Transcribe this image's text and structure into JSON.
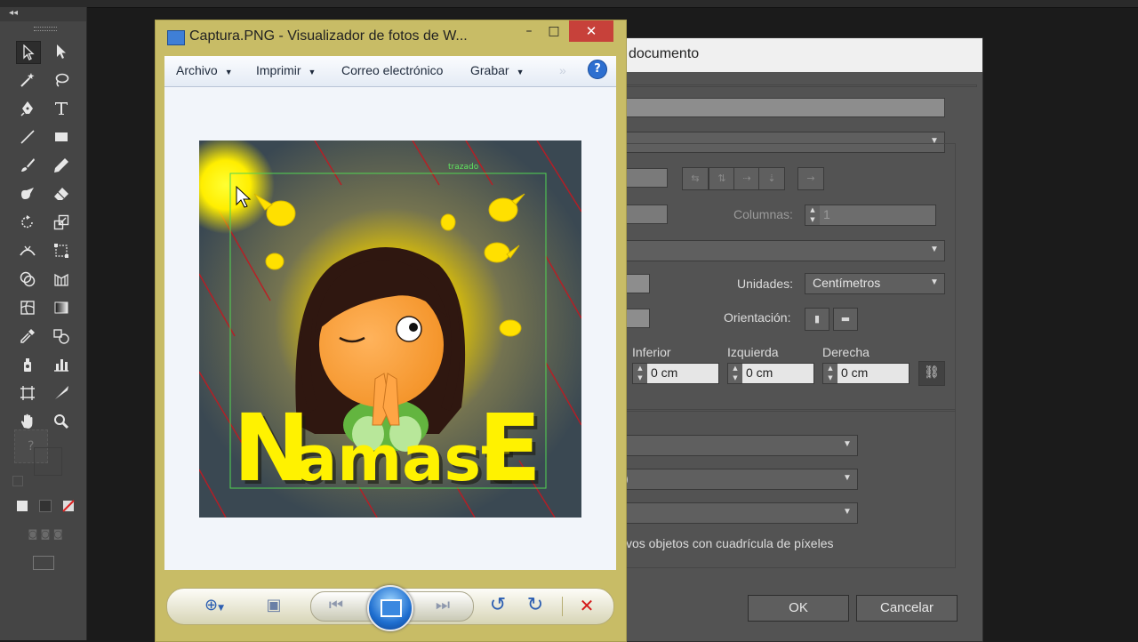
{
  "illustrator": {
    "panel_collapse": "◂◂",
    "fill_question": "?"
  },
  "doc_setup": {
    "title": "documento",
    "columns_label": "Columnas:",
    "columns_value": "1",
    "units_label": "Unidades:",
    "units_value": "Centímetros",
    "orientation_label": "Orientación:",
    "bleed_labels": [
      "Inferior",
      "Izquierda",
      "Derecha"
    ],
    "bleed_values": [
      "0 cm",
      "0 cm",
      "0 cm"
    ],
    "select_partial": ")",
    "pixel_grid_text": "vos objetos con cuadrícula de píxeles",
    "ok_label": "OK",
    "cancel_label": "Cancelar"
  },
  "viewer": {
    "title": "Captura.PNG - Visualizador de fotos de W...",
    "minimize": "–",
    "maximize": "□",
    "close": "✕",
    "menu": [
      "Archivo",
      "Imprimir",
      "Correo electrónico",
      "Grabar"
    ],
    "menu_more": "»",
    "help": "?",
    "artwork_path_label": "trazado",
    "artwork_text": "NamastE",
    "controls": {
      "zoom": "⊕",
      "fit": "▣",
      "prev": "⏮",
      "slideshow": "▭",
      "next": "⏭",
      "rotate_ccw": "↺",
      "rotate_cw": "↻",
      "delete": "✕"
    }
  }
}
